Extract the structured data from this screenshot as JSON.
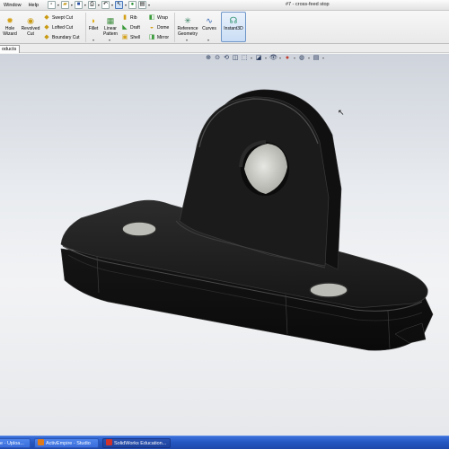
{
  "menubar": {
    "menus": [
      "Window",
      "Help"
    ],
    "doc_title": "#7 - cross-feed stop"
  },
  "ribbon": {
    "hole_wizard": [
      "Hole",
      "Wizard"
    ],
    "revolved_cut": [
      "Revolved",
      "Cut"
    ],
    "swept_cut": "Swept Cut",
    "lofted_cut": "Lofted Cut",
    "boundary_cut": "Boundary Cut",
    "fillet": "Fillet",
    "linear_pattern": [
      "Linear",
      "Pattern"
    ],
    "rib": "Rib",
    "draft": "Draft",
    "shell": "Shell",
    "wrap": "Wrap",
    "dome": "Dome",
    "mirror": "Mirror",
    "reference_geometry": [
      "Reference",
      "Geometry"
    ],
    "curves": "Curves",
    "instant3d": "Instant3D"
  },
  "tabstrip": {
    "tab_label": "oducts"
  },
  "taskbar": {
    "items": [
      "e - Uploa...",
      "ActivEmpire - Studio",
      "SolidWorks Education..."
    ]
  },
  "colors": {
    "model_body": "#1c1c1c",
    "hole_face": "#c8c8c4",
    "taskbar": "#2456c0",
    "instant3d_active": "#c9ddf5"
  }
}
